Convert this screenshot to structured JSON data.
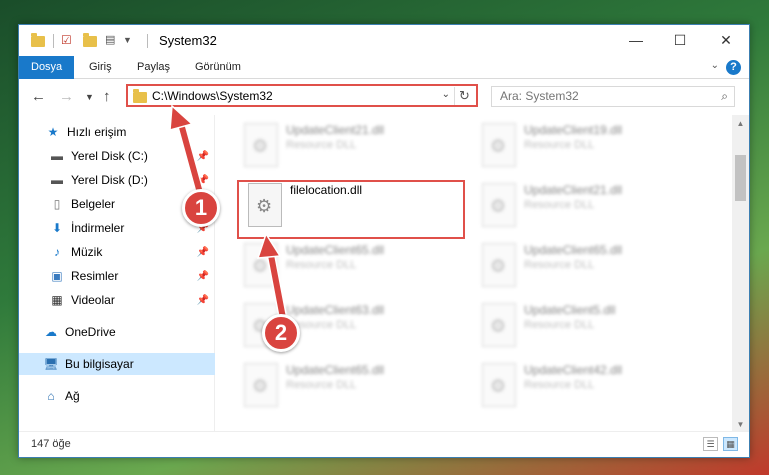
{
  "window": {
    "title": "System32"
  },
  "ribbon": {
    "tabs": [
      "Dosya",
      "Giriş",
      "Paylaş",
      "Görünüm"
    ],
    "active": "Dosya"
  },
  "nav": {
    "address": "C:\\Windows\\System32",
    "search_placeholder": "Ara: System32"
  },
  "sidebar": {
    "items": [
      {
        "label": "Hızlı erişim",
        "icon": "star-icon",
        "pinned": false
      },
      {
        "label": "Yerel Disk (C:)",
        "icon": "drive-icon",
        "pinned": true
      },
      {
        "label": "Yerel Disk (D:)",
        "icon": "drive-icon",
        "pinned": true
      },
      {
        "label": "Belgeler",
        "icon": "document-icon",
        "pinned": true
      },
      {
        "label": "İndirmeler",
        "icon": "download-icon",
        "pinned": true
      },
      {
        "label": "Müzik",
        "icon": "music-icon",
        "pinned": true
      },
      {
        "label": "Resimler",
        "icon": "pictures-icon",
        "pinned": true
      },
      {
        "label": "Videolar",
        "icon": "video-icon",
        "pinned": true
      },
      {
        "label": "OneDrive",
        "icon": "cloud-icon",
        "pinned": false
      },
      {
        "label": "Bu bilgisayar",
        "icon": "computer-icon",
        "pinned": false
      },
      {
        "label": "Ağ",
        "icon": "network-icon",
        "pinned": false
      }
    ],
    "selected": "Bu bilgisayar"
  },
  "files": [
    {
      "name": "UpdateClient21.dll",
      "type": "Resource DLL",
      "blur": true
    },
    {
      "name": "UpdateClient19.dll",
      "type": "Resource DLL",
      "blur": true
    },
    {
      "name": "filelocation.dll",
      "type": "",
      "blur": false
    },
    {
      "name": "UpdateClient21.dll",
      "type": "Resource DLL",
      "blur": true
    },
    {
      "name": "UpdateClient65.dll",
      "type": "Resource DLL",
      "blur": true
    },
    {
      "name": "UpdateClient65.dll",
      "type": "Resource DLL",
      "blur": true
    },
    {
      "name": "UpdateClient63.dll",
      "type": "Resource DLL",
      "blur": true
    },
    {
      "name": "UpdateClient5.dll",
      "type": "Resource DLL",
      "blur": true
    },
    {
      "name": "UpdateClient65.dll",
      "type": "Resource DLL",
      "blur": true
    },
    {
      "name": "UpdateClient42.dll",
      "type": "Resource DLL",
      "blur": true
    }
  ],
  "status": {
    "count": "147 öğe"
  },
  "annotations": {
    "step1": "1",
    "step2": "2"
  },
  "colors": {
    "accent": "#1979ca",
    "annotation": "#d9443f",
    "selection": "#cce8ff"
  }
}
